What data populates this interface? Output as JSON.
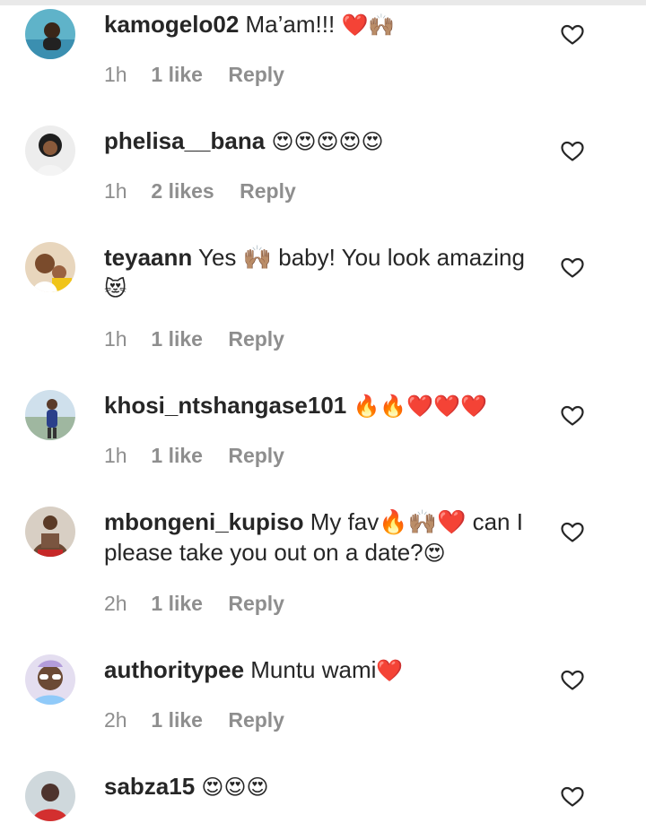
{
  "comments": [
    {
      "username": "kamogelo02",
      "text": " Ma’am!!! ",
      "emoji": "❤️🙌🏽",
      "time": "1h",
      "likes": "1 like",
      "reply": "Reply",
      "avatar_color": "#5fb3c9"
    },
    {
      "username": "phelisa__bana",
      "text": " ",
      "emoji": "😍😍😍😍😍",
      "time": "1h",
      "likes": "2 likes",
      "reply": "Reply",
      "avatar_color": "#d9d9d9"
    },
    {
      "username": "teyaann",
      "text": " Yes 🙌🏽 baby! You look amazing ",
      "emoji": "😻",
      "time": "1h",
      "likes": "1 like",
      "reply": "Reply",
      "avatar_color": "#c9a27a"
    },
    {
      "username": "khosi_ntshangase101",
      "text": " ",
      "emoji": "🔥🔥❤️❤️❤️",
      "time": "1h",
      "likes": "1 like",
      "reply": "Reply",
      "avatar_color": "#8fb0c8"
    },
    {
      "username": "mbongeni_kupiso",
      "text": " My fav🔥🙌🏽❤️ can I please take you out on a date?",
      "emoji": "😍",
      "time": "2h",
      "likes": "1 like",
      "reply": "Reply",
      "avatar_color": "#6b4a35"
    },
    {
      "username": "authoritypee",
      "text": " Muntu wami",
      "emoji": "❤️",
      "time": "2h",
      "likes": "1 like",
      "reply": "Reply",
      "avatar_color": "#8a7aa8"
    },
    {
      "username": "sabza15",
      "text": " ",
      "emoji": "😍😍😍",
      "time": "",
      "likes": "",
      "reply": "",
      "avatar_color": "#b8c2c6"
    }
  ],
  "icons": {
    "like": "heart-outline-icon"
  },
  "colors": {
    "text": "#262626",
    "meta": "#8e8e8e",
    "emoji_heart": "#e0245e"
  }
}
